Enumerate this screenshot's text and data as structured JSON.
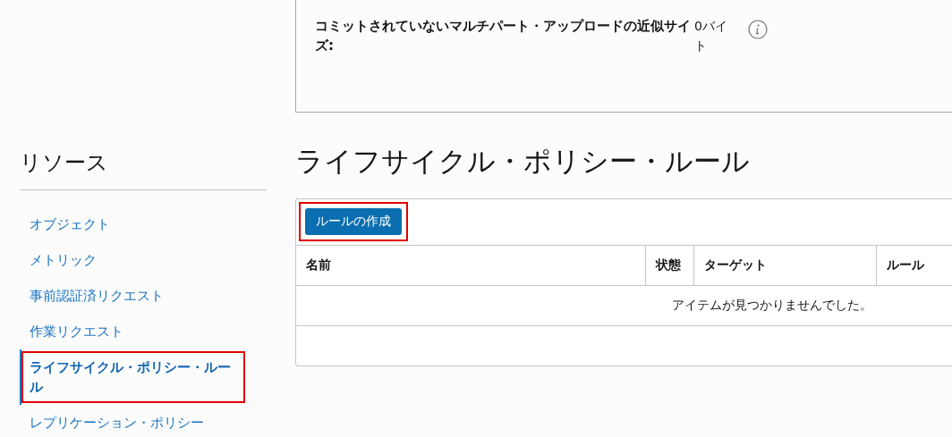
{
  "details": {
    "label": "コミットされていないマルチパート・アップロードの近似サイズ:",
    "value": "0バイト"
  },
  "sidebar": {
    "title": "リソース",
    "items": [
      {
        "label": "オブジェクト",
        "selected": false,
        "highlighted": false
      },
      {
        "label": "メトリック",
        "selected": false,
        "highlighted": false
      },
      {
        "label": "事前認証済リクエスト",
        "selected": false,
        "highlighted": false
      },
      {
        "label": "作業リクエスト",
        "selected": false,
        "highlighted": false
      },
      {
        "label": "ライフサイクル・ポリシー・ルール",
        "selected": true,
        "highlighted": true
      },
      {
        "label": "レプリケーション・ポリシー",
        "selected": false,
        "highlighted": false
      }
    ]
  },
  "section": {
    "title": "ライフサイクル・ポリシー・ルール",
    "create_button": {
      "label": "ルールの作成",
      "highlighted": true
    },
    "table": {
      "columns": [
        "名前",
        "状態",
        "ターゲット",
        "ルール"
      ],
      "empty_message": "アイテムが見つかりませんでした。"
    }
  }
}
